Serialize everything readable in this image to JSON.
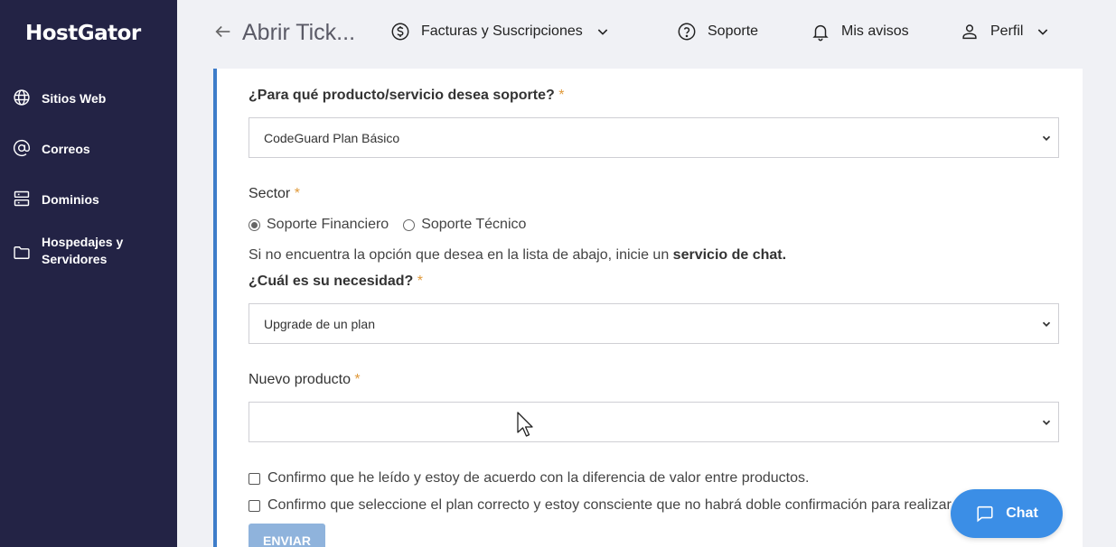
{
  "brand": {
    "logo": "HostGator"
  },
  "sidebar": {
    "items": [
      {
        "label": "Sitios Web",
        "icon": "globe-icon"
      },
      {
        "label": "Correos",
        "icon": "at-icon"
      },
      {
        "label": "Dominios",
        "icon": "server-icon"
      },
      {
        "label": "Hospedajes y Servidores",
        "icon": "folder-icon"
      }
    ]
  },
  "header": {
    "title": "Abrir Tick...",
    "billing": "Facturas y Suscripciones",
    "support": "Soporte",
    "notices": "Mis avisos",
    "profile": "Perfil"
  },
  "form": {
    "product_label": "¿Para qué producto/servicio desea soporte?",
    "product_value": "CodeGuard Plan Básico",
    "sector_label": "Sector",
    "sector_options": [
      "Soporte Financiero",
      "Soporte Técnico"
    ],
    "sector_selected": "Soporte Financiero",
    "info_text": "Si no encuentra la opción que desea en la lista de abajo, inicie un",
    "info_bold": "servicio de chat.",
    "need_label": "¿Cuál es su necesidad?",
    "need_value": "Upgrade de un plan",
    "new_product_label": "Nuevo producto",
    "new_product_value": "",
    "required_mark": "*",
    "check1": "Confirmo que he leído y estoy de acuerdo con la diferencia de valor entre productos.",
    "check2": "Confirmo que seleccione el plan correcto y estoy consciente que no habrá doble confirmación para realizar el",
    "submit": "ENVIAR"
  },
  "chat": {
    "label": "Chat"
  },
  "colors": {
    "sidebar": "#232345",
    "accent": "#3d7cc9",
    "chat": "#3b8ee6",
    "required": "#e09a3c"
  }
}
